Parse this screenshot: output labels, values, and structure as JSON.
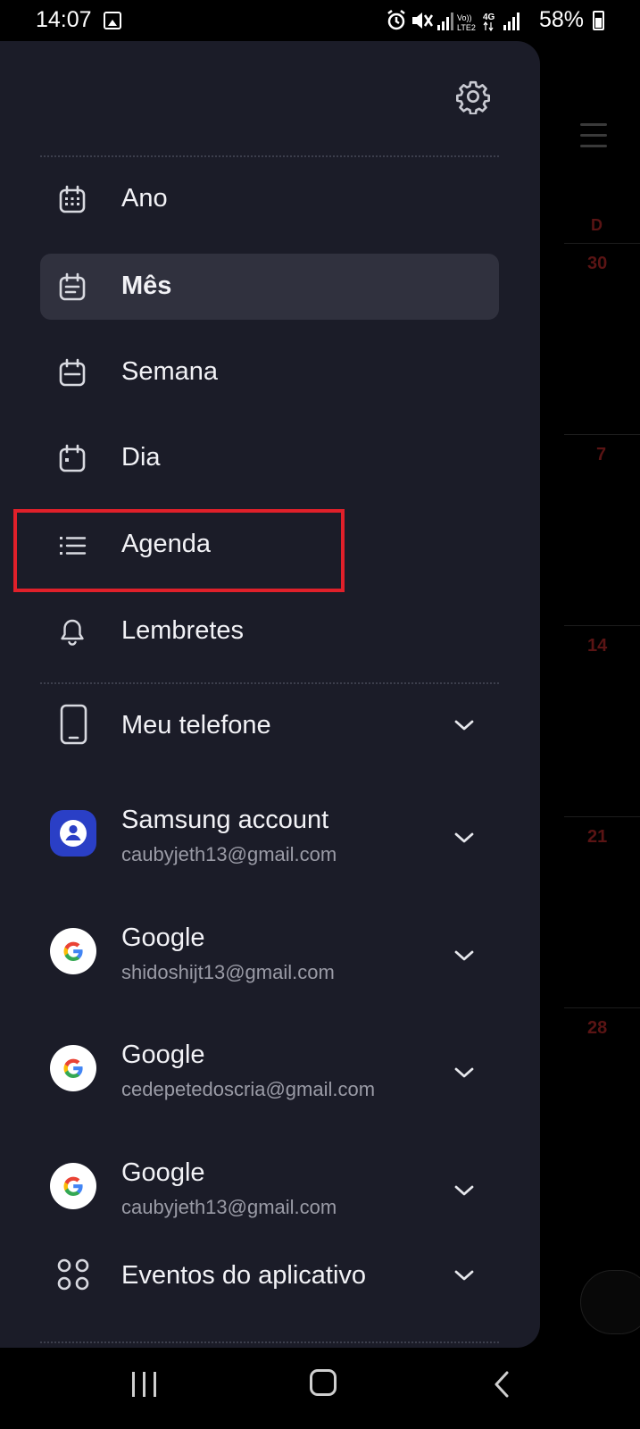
{
  "status_bar": {
    "time": "14:07",
    "network_volte": "Vo)) LTE2",
    "network_type": "4G",
    "battery": "58%"
  },
  "background_calendar": {
    "weekday_header": "D",
    "days": [
      "30",
      "7",
      "14",
      "21",
      "28"
    ]
  },
  "drawer": {
    "settings_icon": "gear-icon",
    "views": [
      {
        "label": "Ano",
        "icon": "calendar-grid-icon"
      },
      {
        "label": "Mês",
        "icon": "calendar-month-icon",
        "selected": true
      },
      {
        "label": "Semana",
        "icon": "calendar-week-icon"
      },
      {
        "label": "Dia",
        "icon": "calendar-day-icon"
      },
      {
        "label": "Agenda",
        "icon": "list-icon"
      },
      {
        "label": "Lembretes",
        "icon": "bell-icon"
      }
    ],
    "accounts": [
      {
        "name": "Meu telefone",
        "email": "",
        "icon": "phone-icon"
      },
      {
        "name": "Samsung account",
        "email": "caubyjeth13@gmail.com",
        "icon": "samsung-account-icon"
      },
      {
        "name": "Google",
        "email": "shidoshijt13@gmail.com",
        "icon": "google-icon"
      },
      {
        "name": "Google",
        "email": "cedepetedoscria@gmail.com",
        "icon": "google-icon"
      },
      {
        "name": "Google",
        "email": "caubyjeth13@gmail.com",
        "icon": "google-icon"
      },
      {
        "name": "Eventos do aplicativo",
        "email": "",
        "icon": "apps-icon"
      }
    ]
  },
  "colors": {
    "drawer_bg": "#1b1c28",
    "selected_bg": "#30313e",
    "highlight_border": "#e0202a",
    "samsung_blue": "#2a3fc6"
  }
}
